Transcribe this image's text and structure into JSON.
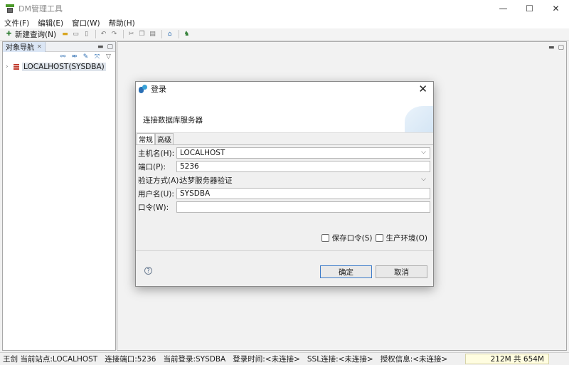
{
  "window": {
    "title": "DM管理工具",
    "controls": [
      "—",
      "☐",
      "✕"
    ]
  },
  "menu": [
    "文件(F)",
    "编辑(E)",
    "窗口(W)",
    "帮助(H)"
  ],
  "toolbar": {
    "new_query": "新建查询(N)"
  },
  "navigator": {
    "tab_label": "对象导航",
    "tree": [
      {
        "label": "LOCALHOST(SYSDBA)",
        "icon": "database-icon"
      }
    ]
  },
  "dialog": {
    "title": "登录",
    "subtitle": "连接数据库服务器",
    "tabs": [
      "常规",
      "高级"
    ],
    "fields": {
      "host": {
        "label": "主机名(H):",
        "value": "LOCALHOST"
      },
      "port": {
        "label": "端口(P):",
        "value": "5236"
      },
      "auth": {
        "label": "验证方式(A):",
        "value": "达梦服务器验证"
      },
      "user": {
        "label": "用户名(U):",
        "value": "SYSDBA"
      },
      "password": {
        "label": "口令(W):",
        "value": ""
      }
    },
    "save_password": "保存口令(S)",
    "production_env": "生产环境(O)",
    "ok": "确定",
    "cancel": "取消"
  },
  "status": {
    "items": [
      "王剑 当前站点:LOCALHOST",
      "连接端口:5236",
      "当前登录:SYSDBA",
      "登录时间:<未连接>",
      "SSL连接:<未连接>",
      "授权信息:<未连接>"
    ],
    "memory": "212M 共 654M"
  },
  "colors": {
    "accent": "#3d7cc9",
    "status_memory_bg": "#fffde0",
    "tree_selected_bg": "#dde3ea"
  }
}
